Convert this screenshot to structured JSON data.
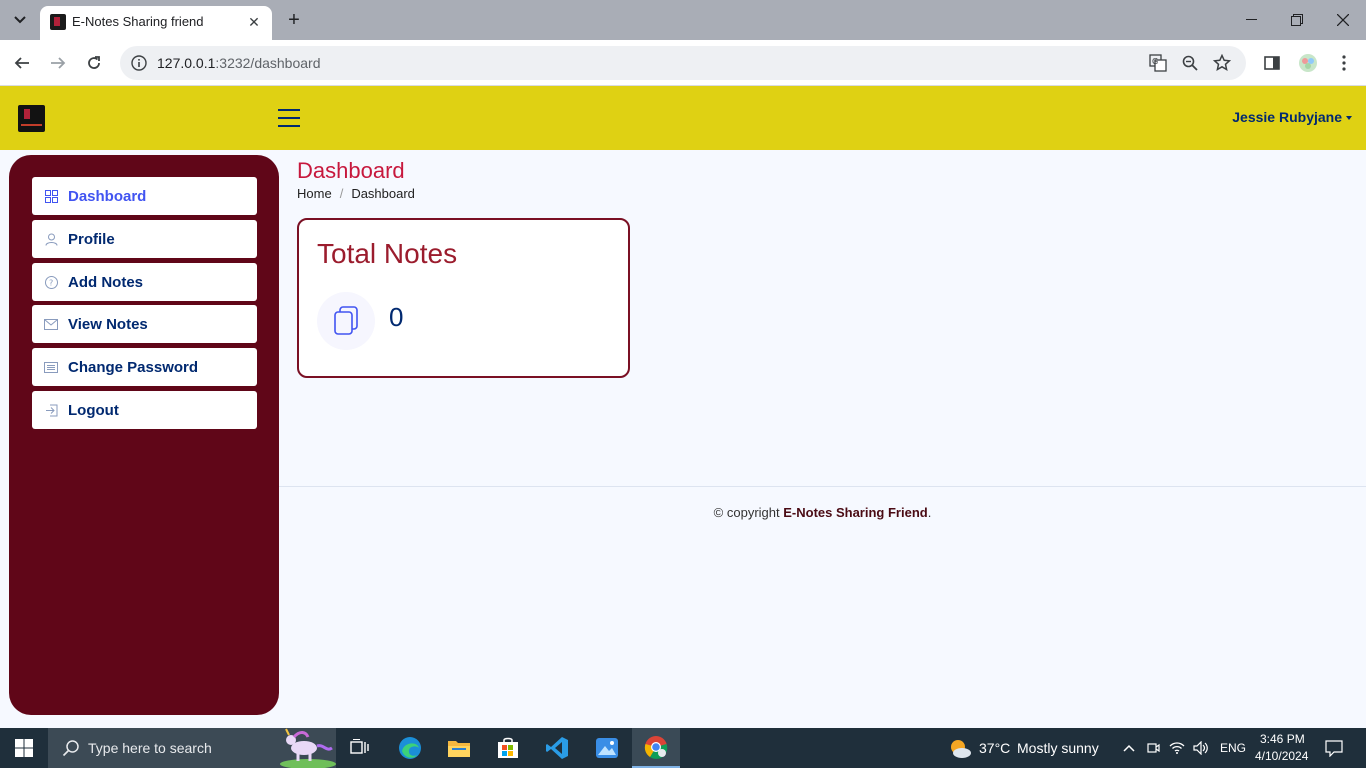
{
  "browser": {
    "tab_title": "E-Notes Sharing friend",
    "url_host": "127.0.0.1",
    "url_rest": ":3232/dashboard"
  },
  "header": {
    "user_name": "Jessie Rubyjane"
  },
  "sidebar": {
    "items": [
      {
        "label": "Dashboard",
        "icon": "grid-icon",
        "active": true
      },
      {
        "label": "Profile",
        "icon": "person-icon"
      },
      {
        "label": "Add Notes",
        "icon": "question-circle-icon"
      },
      {
        "label": "View Notes",
        "icon": "envelope-icon"
      },
      {
        "label": "Change Password",
        "icon": "card-list-icon"
      },
      {
        "label": "Logout",
        "icon": "box-arrow-in-left-icon"
      }
    ]
  },
  "main": {
    "title": "Dashboard",
    "breadcrumb": [
      "Home",
      "Dashboard"
    ],
    "card": {
      "title": "Total Notes",
      "count": "0",
      "icon": "files-icon"
    }
  },
  "footer": {
    "prefix": "© copyright ",
    "brand": "E-Notes Sharing Friend",
    "suffix": "."
  },
  "taskbar": {
    "search_placeholder": "Type here to search",
    "weather_temp": "37°C",
    "weather_text": "Mostly sunny",
    "language": "ENG",
    "time": "3:46 PM",
    "date": "4/10/2024"
  },
  "colors": {
    "header_bg": "#dfd113",
    "sidebar_bg": "#600618",
    "title_color": "#c7183d",
    "card_border": "#7a1024",
    "nav_text": "#012970",
    "nav_active": "#4154f1"
  }
}
